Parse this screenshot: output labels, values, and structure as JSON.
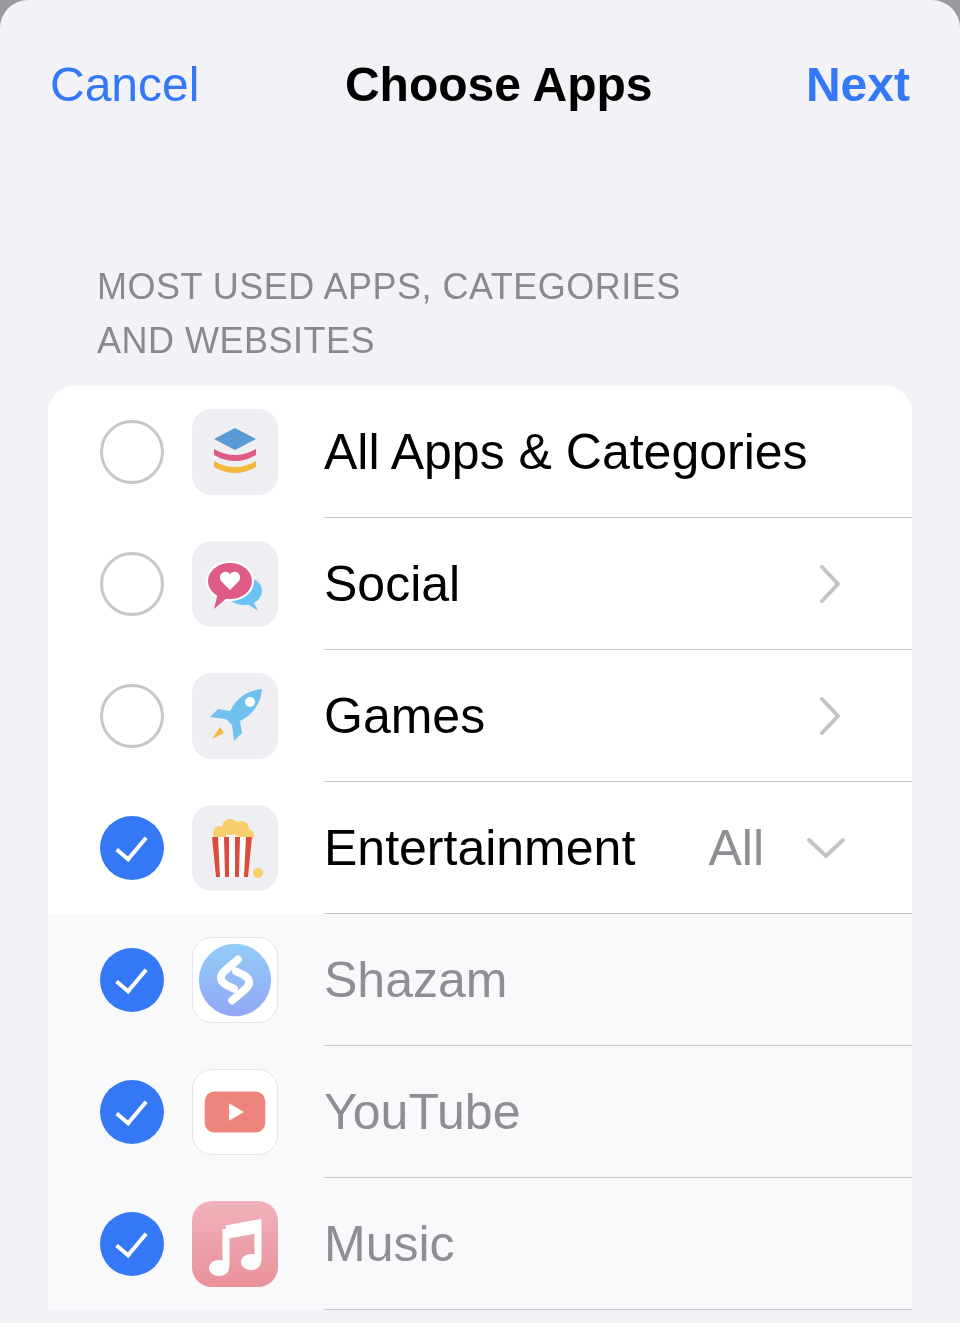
{
  "nav": {
    "cancel": "Cancel",
    "title": "Choose Apps",
    "next": "Next"
  },
  "section_header": "MOST USED APPS, CATEGORIES AND WEBSITES",
  "items": [
    {
      "kind": "all",
      "label": "All Apps & Categories",
      "checked": false
    },
    {
      "kind": "category",
      "label": "Social",
      "checked": false,
      "expanded": false
    },
    {
      "kind": "category",
      "label": "Games",
      "checked": false,
      "expanded": false
    },
    {
      "kind": "category",
      "label": "Entertainment",
      "checked": true,
      "expanded": true,
      "value": "All",
      "children": [
        {
          "kind": "app",
          "label": "Shazam",
          "checked": true
        },
        {
          "kind": "app",
          "label": "YouTube",
          "checked": true
        },
        {
          "kind": "app",
          "label": "Music",
          "checked": true
        }
      ]
    }
  ]
}
